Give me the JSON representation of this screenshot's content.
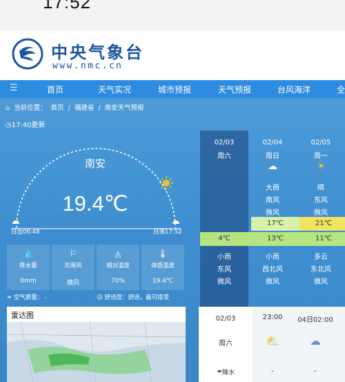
{
  "status_bar": {
    "time": "17:52"
  },
  "header": {
    "logo_cn": "中央气象台",
    "logo_en": "www.nmc.cn"
  },
  "nav": {
    "menu_icon": "hamburger-icon",
    "items": [
      "首页",
      "天气实况",
      "城市预报",
      "天气预报",
      "台风海洋",
      "全"
    ]
  },
  "breadcrumb": {
    "prefix": "当前位置：",
    "items": [
      "首页",
      "/",
      "福建省",
      "/",
      "南安天气预报"
    ]
  },
  "update_time": "17:40更新",
  "current": {
    "city": "南安",
    "temperature": "19.4℃",
    "sunrise": "日出06:48",
    "sunset": "日落17:52",
    "sun_position": 0.92
  },
  "stats": [
    {
      "icon": "rain-drops-icon",
      "label": "降水量",
      "value": "0mm"
    },
    {
      "icon": "wind-vane-icon",
      "label": "东南风",
      "value": "微风"
    },
    {
      "icon": "humidity-drop-icon",
      "label": "相对湿度",
      "value": "70%"
    },
    {
      "icon": "thermometer-icon",
      "label": "体感温度",
      "value": "19.4℃"
    }
  ],
  "air_quality": {
    "label": "空气质量：",
    "value": "-",
    "comfort_label": "舒适度：",
    "comfort_value": "舒适，最可接受"
  },
  "radar": {
    "title": "雷达图"
  },
  "forecast": [
    {
      "date": "02/03",
      "weekday": "周六",
      "day_weather": "",
      "day_wind_dir": "",
      "day_wind_force": "",
      "high": "",
      "low": "4℃",
      "night_weather": "小雨",
      "night_wind_dir": "东风",
      "night_wind_force": "微风"
    },
    {
      "date": "02/04",
      "weekday": "周日",
      "day_weather": "大雨",
      "day_wind_dir": "南风",
      "day_wind_force": "微风",
      "high": "17℃",
      "low": "13℃",
      "night_weather": "小雨",
      "night_wind_dir": "西北风",
      "night_wind_force": "微风"
    },
    {
      "date": "02/05",
      "weekday": "周一",
      "day_weather": "晴",
      "day_wind_dir": "东风",
      "day_wind_force": "微风",
      "high": "21℃",
      "low": "11℃",
      "night_weather": "多云",
      "night_wind_dir": "东北风",
      "night_wind_force": "微风"
    }
  ],
  "hourly": {
    "first_col": {
      "date": "02/03",
      "weekday": "周六",
      "row_label": "降水"
    },
    "times": [
      "23:00",
      "04日02:00"
    ],
    "precip": [
      "-",
      "-"
    ]
  },
  "colors": {
    "nav_blue": "#2d8be0",
    "sky_blue": "#4d9ad6",
    "high_band": "#d8f0a8",
    "low_band": "#b5e480",
    "high_hot": "#f2e35e"
  }
}
